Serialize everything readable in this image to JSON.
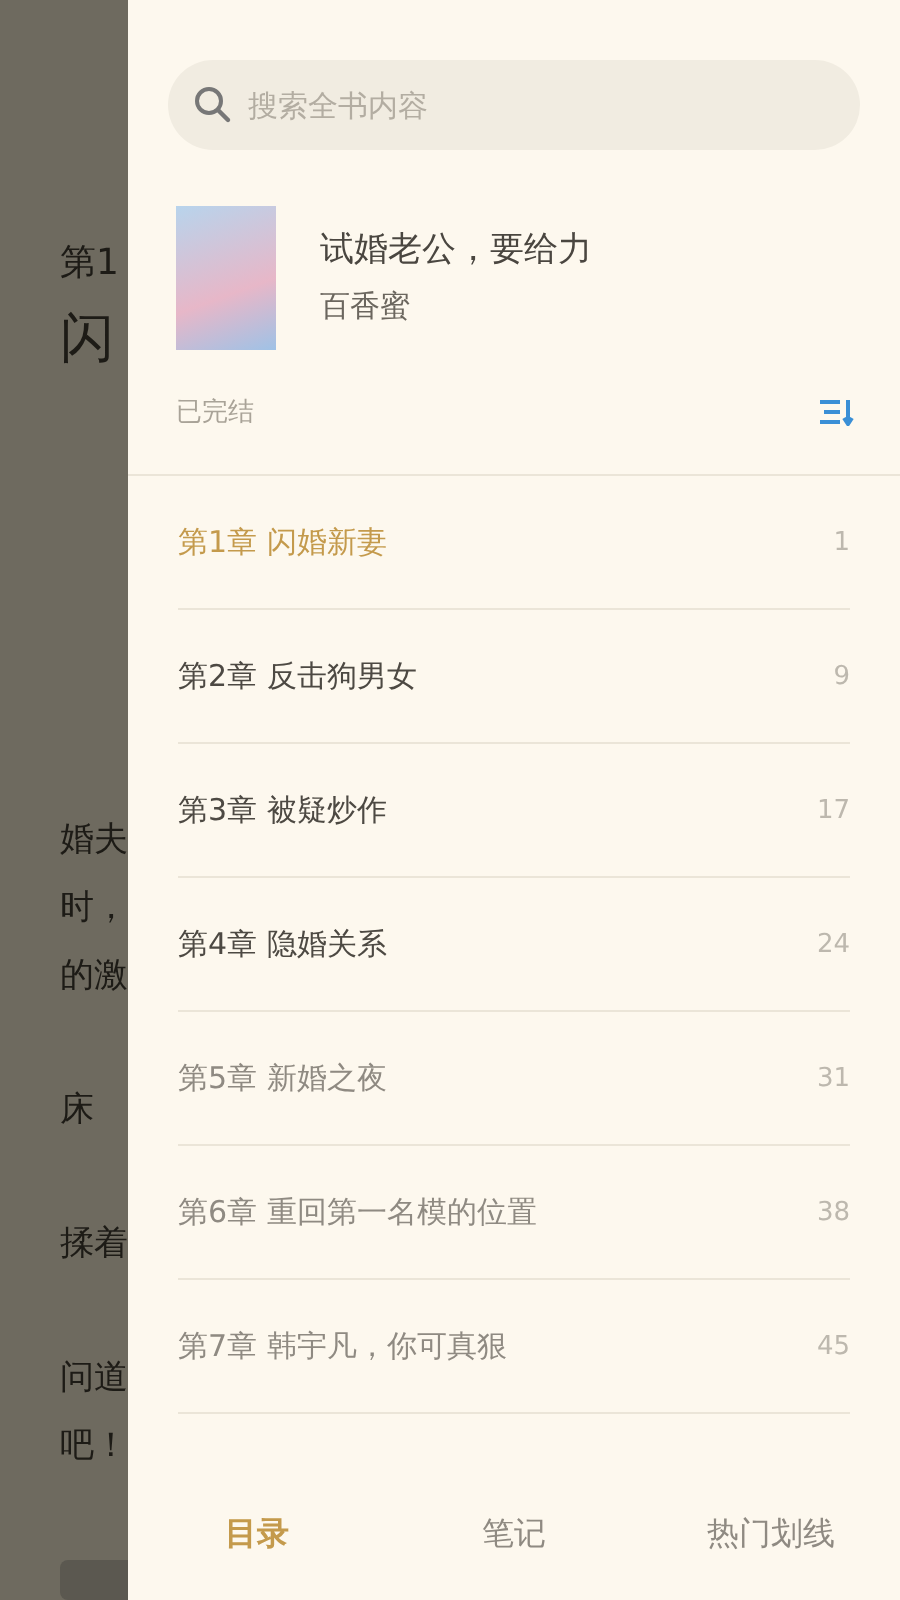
{
  "reader_page": {
    "heading_parts": [
      "第1",
      "闪"
    ],
    "text_fragments": [
      "婚夫",
      "时，",
      "的激",
      "床",
      "揉着",
      "问道",
      "吧！"
    ]
  },
  "drawer": {
    "search": {
      "placeholder": "搜索全书内容"
    },
    "book": {
      "title": "试婚老公，要给力",
      "author": "百香蜜",
      "status": "已完结"
    },
    "chapters": [
      {
        "title": "第1章 闪婚新妻",
        "page": "1",
        "selected": true,
        "dimmed": false
      },
      {
        "title": "第2章 反击狗男女",
        "page": "9",
        "selected": false,
        "dimmed": false
      },
      {
        "title": "第3章 被疑炒作",
        "page": "17",
        "selected": false,
        "dimmed": false
      },
      {
        "title": "第4章 隐婚关系",
        "page": "24",
        "selected": false,
        "dimmed": false
      },
      {
        "title": "第5章 新婚之夜",
        "page": "31",
        "selected": false,
        "dimmed": true
      },
      {
        "title": "第6章 重回第一名模的位置",
        "page": "38",
        "selected": false,
        "dimmed": true
      },
      {
        "title": "第7章 韩宇凡，你可真狠",
        "page": "45",
        "selected": false,
        "dimmed": true
      }
    ],
    "tabs": [
      {
        "label": "目录",
        "selected": true
      },
      {
        "label": "笔记",
        "selected": false
      },
      {
        "label": "热门划线",
        "selected": false
      }
    ]
  }
}
